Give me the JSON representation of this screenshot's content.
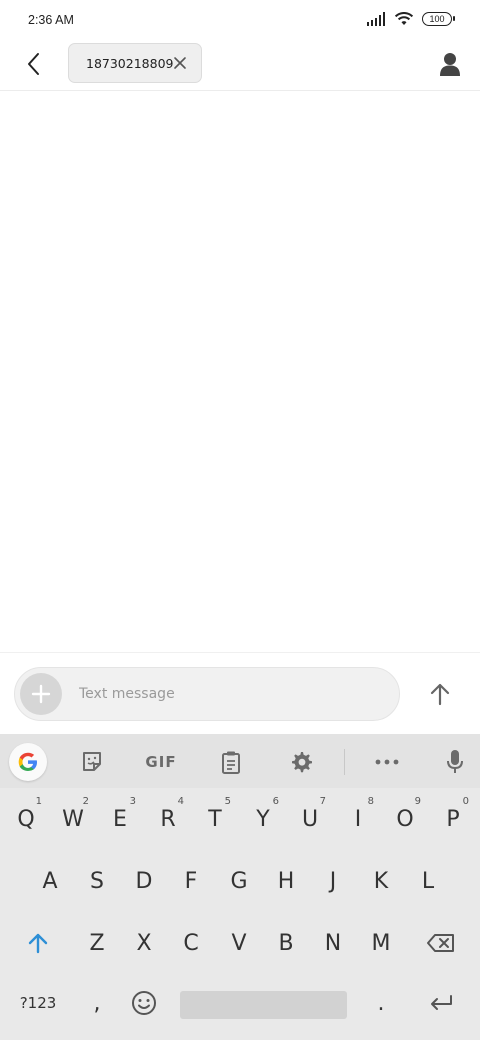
{
  "status_bar": {
    "time": "2:36 AM",
    "battery": "100"
  },
  "header": {
    "recipient": "18730218809"
  },
  "compose": {
    "placeholder": "Text message"
  },
  "keyboard": {
    "toolbar": {
      "gif_label": "GIF"
    },
    "row1": [
      {
        "label": "Q",
        "hint": "1"
      },
      {
        "label": "W",
        "hint": "2"
      },
      {
        "label": "E",
        "hint": "3"
      },
      {
        "label": "R",
        "hint": "4"
      },
      {
        "label": "T",
        "hint": "5"
      },
      {
        "label": "Y",
        "hint": "6"
      },
      {
        "label": "U",
        "hint": "7"
      },
      {
        "label": "I",
        "hint": "8"
      },
      {
        "label": "O",
        "hint": "9"
      },
      {
        "label": "P",
        "hint": "0"
      }
    ],
    "row2": [
      "A",
      "S",
      "D",
      "F",
      "G",
      "H",
      "J",
      "K",
      "L"
    ],
    "row3": [
      "Z",
      "X",
      "C",
      "V",
      "B",
      "N",
      "M"
    ],
    "row4": {
      "symbols": "?123",
      "comma": ",",
      "period": "."
    }
  },
  "colors": {
    "accent_blue": "#2d8fd6",
    "keyboard_bg": "#e9e9e9",
    "icon_gray": "#6b6b6b"
  },
  "icons": [
    "back-arrow",
    "close-x",
    "person",
    "plus",
    "arrow-up",
    "google-g",
    "sticker",
    "clipboard",
    "gear",
    "more-dots",
    "mic",
    "shift-arrow",
    "backspace",
    "emoji",
    "enter"
  ]
}
